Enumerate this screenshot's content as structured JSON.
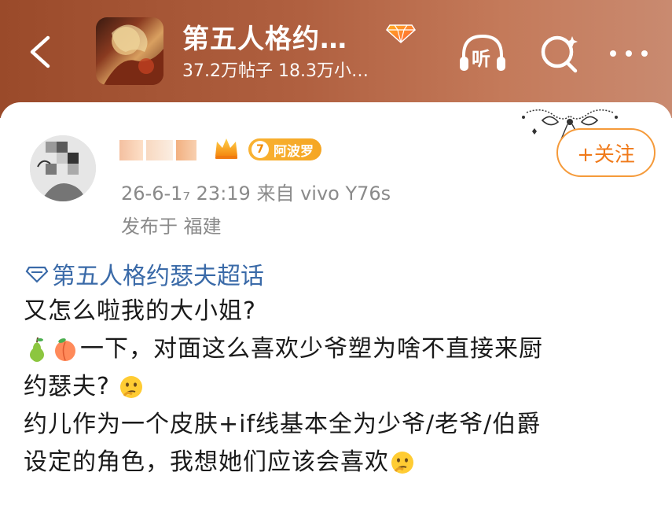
{
  "header": {
    "title": "第五人格约…",
    "subtitle": "37.2万帖子 18.3万小…",
    "listen_label": "听"
  },
  "post": {
    "username_hidden": true,
    "level_number": "7",
    "level_name": "阿波罗",
    "meta_line": "26-6-1₇ 23:19  来自 vivo Y76s",
    "location": "发布于 福建",
    "follow_label": "+关注",
    "topic": "第五人格约瑟夫超话",
    "lines": [
      "又怎么啦我的大小姐?",
      "一下，对面这么喜欢少爷塑为啥不直接来厨",
      "约瑟夫?",
      "约儿作为一个皮肤+if线基本全为少爷/老爷/伯爵",
      "设定的角色，我想她们应该会喜欢"
    ]
  },
  "colors": {
    "accent": "#f07a1a",
    "topic": "#3a6aa8",
    "meta": "#8a8a8a"
  }
}
